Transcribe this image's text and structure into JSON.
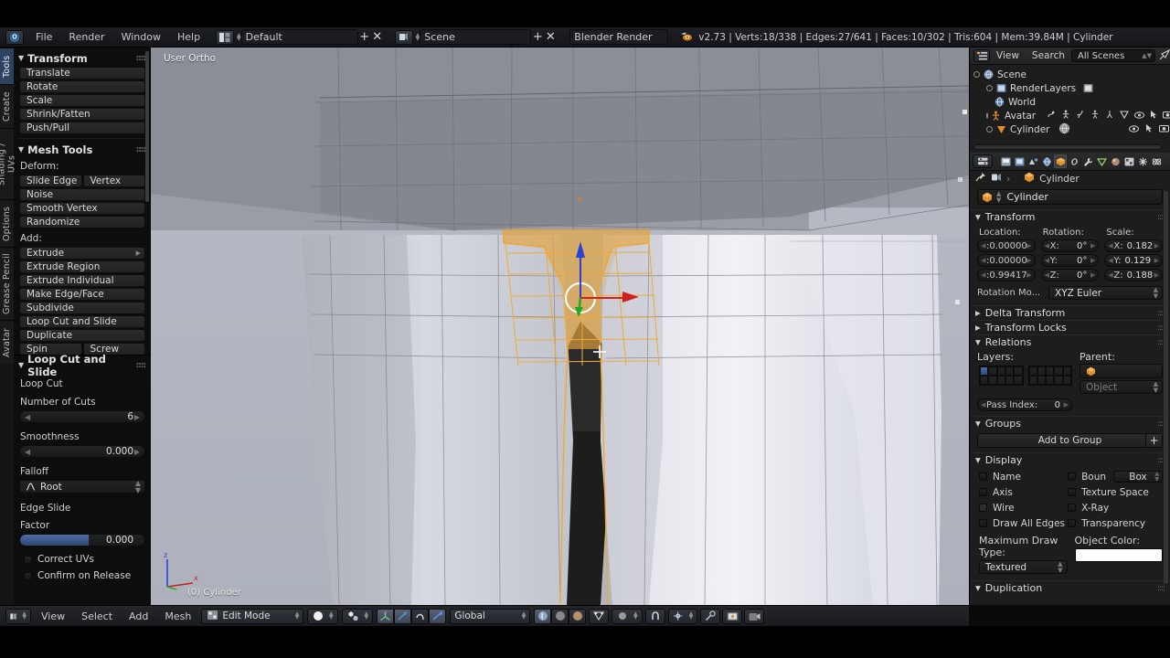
{
  "topbar": {
    "logo_icon": "blender-logo-icon",
    "layout_icon": "screen-layout-icon",
    "menus": [
      "File",
      "Render",
      "Window",
      "Help"
    ],
    "screen_layout": "Default",
    "scene_icon": "scene-icon",
    "scene_name": "Scene",
    "add_label": "+",
    "remove_label": "✕",
    "engine": "Blender Render",
    "blender_icon": "blender-mark-icon",
    "stats": "v2.73 | Verts:18/338 | Edges:27/641 | Faces:10/302 | Tris:604 | Mem:39.84M | Cylinder"
  },
  "toolshelf": {
    "tabs": [
      {
        "label": "Tools",
        "active": true
      },
      {
        "label": "Create",
        "active": false
      },
      {
        "label": "Shading / UVs",
        "active": false
      },
      {
        "label": "Options",
        "active": false
      },
      {
        "label": "Grease Pencil",
        "active": false
      },
      {
        "label": "Avatar",
        "active": false
      }
    ],
    "transform": {
      "title": "Transform",
      "buttons": [
        "Translate",
        "Rotate",
        "Scale",
        "Shrink/Fatten",
        "Push/Pull"
      ]
    },
    "mesh_tools": {
      "title": "Mesh Tools",
      "deform_label": "Deform:",
      "deform_pair": [
        "Slide Edge",
        "Vertex"
      ],
      "deform_rest": [
        "Noise",
        "Smooth Vertex",
        "Randomize"
      ],
      "add_label": "Add:",
      "add_items": [
        "Extrude",
        "Extrude Region",
        "Extrude Individual",
        "Make Edge/Face",
        "Subdivide",
        "Loop Cut and Slide",
        "Duplicate"
      ],
      "add_pair": [
        "Spin",
        "Screw"
      ]
    },
    "operator": {
      "title": "Loop Cut and Slide",
      "section1": "Loop Cut",
      "cuts_label": "Number of Cuts",
      "cuts_value": "6",
      "smoothness_label": "Smoothness",
      "smoothness_value": "0.000",
      "falloff_label": "Falloff",
      "falloff_value": "Root",
      "falloff_icon": "falloff-curve-icon",
      "section2": "Edge Slide",
      "factor_label": "Factor",
      "factor_value": "0.000",
      "checkboxes": [
        {
          "label": "Correct UVs",
          "checked": false
        },
        {
          "label": "Confirm on Release",
          "checked": false
        }
      ]
    }
  },
  "viewport": {
    "view_label": "User Ortho",
    "object_label": "(0) Cylinder",
    "axis_x": "x",
    "axis_z": "z",
    "gizmo": "3d-manipulator-widget",
    "cursor": "crosshair-cursor"
  },
  "outliner": {
    "display_mode_icon": "outliner-display-mode-icon",
    "menus": [
      "View",
      "Search"
    ],
    "scope": "All Scenes",
    "filter_icon": "filter-icon",
    "rows": [
      {
        "label": "Scene",
        "icon": "scene-icon",
        "indent": 0,
        "expander": true
      },
      {
        "label": "RenderLayers",
        "icon": "renderlayers-icon",
        "indent": 1,
        "expander": true,
        "extra": [
          "renderlayer-badge-icon"
        ]
      },
      {
        "label": "World",
        "icon": "world-icon",
        "indent": 1,
        "expander": false
      },
      {
        "label": "Avatar",
        "icon": "armature-icon",
        "indent": 1,
        "expander": true,
        "tools": [
          "modifier-icon",
          "armature-data-icon",
          "pose-icon",
          "armature-pose-icon",
          "bone-icon",
          "mesh-data-icon",
          "eye-icon",
          "cursor-select-icon",
          "camera-render-icon"
        ]
      },
      {
        "label": "Cylinder",
        "icon": "mesh-object-icon",
        "indent": 1,
        "expander": true,
        "tools": [
          "mesh-data-sphere-icon",
          "eye-icon",
          "cursor-select-icon",
          "camera-render-icon"
        ]
      }
    ]
  },
  "properties": {
    "tabs": [
      {
        "icon": "render-icon",
        "sel": false
      },
      {
        "icon": "render-layers-icon",
        "sel": false
      },
      {
        "icon": "scene-icon",
        "sel": false
      },
      {
        "icon": "world-icon",
        "sel": false
      },
      {
        "icon": "object-icon",
        "sel": true
      },
      {
        "icon": "constraints-icon",
        "sel": false
      },
      {
        "icon": "modifiers-wrench-icon",
        "sel": false
      },
      {
        "icon": "object-data-icon",
        "sel": false
      },
      {
        "icon": "material-icon",
        "sel": false
      },
      {
        "icon": "texture-icon",
        "sel": false
      },
      {
        "icon": "particles-icon",
        "sel": false
      },
      {
        "icon": "physics-icon",
        "sel": false
      }
    ],
    "breadcrumb": {
      "pin_icon": "pin-icon",
      "scene_icon": "scene-icon",
      "sep": "›",
      "object_icon": "object-cube-icon",
      "object_name": "Cylinder"
    },
    "name_field": {
      "icon": "object-cube-icon",
      "value": "Cylinder"
    },
    "transform": {
      "title": "Transform",
      "location_label": "Location:",
      "rotation_label": "Rotation:",
      "scale_label": "Scale:",
      "location": [
        ":0.00000",
        ":0.00000",
        ":0.99417"
      ],
      "rotation_axes": [
        "X:",
        "Y:",
        "Z:"
      ],
      "rotation": [
        "0°",
        "0°",
        "0°"
      ],
      "scale_axes": [
        "X:",
        "Y:",
        "Z:"
      ],
      "scale": [
        "0.182",
        "0.129",
        "0.188"
      ],
      "rotation_mode_label": "Rotation Mo...",
      "rotation_mode_value": "XYZ Euler"
    },
    "delta_transform": "Delta Transform",
    "transform_locks": "Transform Locks",
    "relations": {
      "title": "Relations",
      "layers_label": "Layers:",
      "parent_label": "Parent:",
      "parent_value": "",
      "parent_icon": "object-cube-icon",
      "parent_type": "Object",
      "pass_index_label": "Pass Index:",
      "pass_index_value": "0"
    },
    "groups": {
      "title": "Groups",
      "add_label": "Add to Group",
      "add_plus": "+"
    },
    "display": {
      "title": "Display",
      "checkboxes": [
        {
          "label": "Name",
          "checked": false
        },
        {
          "label": "Boun",
          "checked": false
        },
        {
          "label": "Axis",
          "checked": false
        },
        {
          "label": "Texture Space",
          "checked": false
        },
        {
          "label": "Wire",
          "checked": true
        },
        {
          "label": "X-Ray",
          "checked": false
        },
        {
          "label": "Draw All Edges",
          "checked": false
        },
        {
          "label": "Transparency",
          "checked": false
        }
      ],
      "bounds_value": "Box",
      "max_draw_label": "Maximum Draw Type:",
      "max_draw_value": "Textured",
      "object_color_label": "Object Color:",
      "object_color": "#ffffff"
    },
    "duplication": "Duplication"
  },
  "viewport_footer": {
    "editor_icon": "editor-type-3dview-icon",
    "menus": [
      "View",
      "Select",
      "Add",
      "Mesh"
    ],
    "mode_icon": "edit-mode-icon",
    "mode": "Edit Mode",
    "shading_icon": "viewport-shading-solid-icon",
    "select_mode_icon": "vertex-select-mode-icon",
    "manipulator_icons": [
      "manipulator-toggle-icon",
      "translate-manipulator-icon",
      "rotate-manipulator-icon",
      "scale-manipulator-icon"
    ],
    "orientation": "Global",
    "proportional_icons": [
      "proportional-edit-icon",
      "proportional-falloff-icon"
    ],
    "pivot_icon": "pivot-median-icon",
    "snap_icons": [
      "snap-magnet-icon",
      "snap-target-icon"
    ],
    "occlude_icon": "limit-selection-visible-icon",
    "render_icons": [
      "render-icon",
      "render-animation-icon"
    ],
    "draw_type_icons": [
      "draw-type-rendered-icon",
      "draw-type-solid-icon",
      "draw-type-material-icon"
    ]
  }
}
